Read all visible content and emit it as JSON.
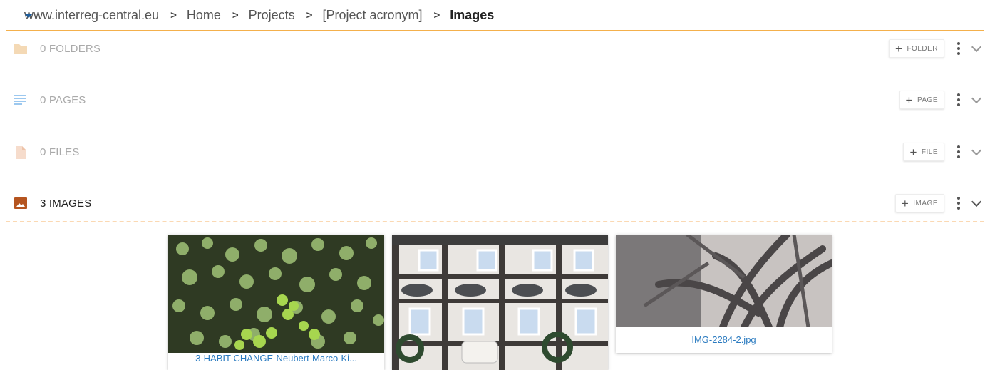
{
  "breadcrumb": {
    "items": [
      "www.interreg-central.eu",
      "Home",
      "Projects",
      "[Project acronym]"
    ],
    "current": "Images",
    "separator": ">"
  },
  "sections": {
    "folders": {
      "label": "0 FOLDERS",
      "button": "FOLDER",
      "icon": "folder-icon"
    },
    "pages": {
      "label": "0 PAGES",
      "button": "PAGE",
      "icon": "page-lines-icon"
    },
    "files": {
      "label": "0 FILES",
      "button": "FILE",
      "icon": "file-icon"
    },
    "images": {
      "label": "3 IMAGES",
      "button": "IMAGE",
      "icon": "image-icon"
    }
  },
  "images": [
    {
      "name": "3-HABIT-CHANGE-Neubert-Marco-Ki...",
      "thumb": "duckweed-pond-photo"
    },
    {
      "name": "",
      "thumb": "half-timbered-facade-photo"
    },
    {
      "name": "IMG-2284-2.jpg",
      "thumb": "branch-shadow-photo"
    }
  ],
  "colors": {
    "accent": "#f4b04c",
    "link": "#2b7bc0",
    "images_icon": "#b5541f"
  }
}
